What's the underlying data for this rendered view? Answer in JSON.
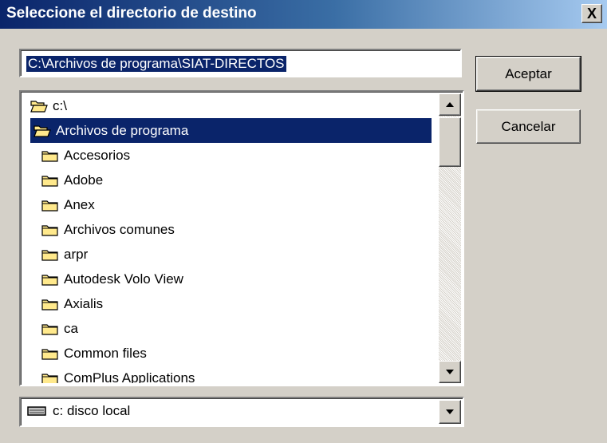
{
  "window": {
    "title": "Seleccione el directorio de destino",
    "close_label": "X"
  },
  "path": {
    "value": "C:\\Archivos de programa\\SIAT-DIRECTOS"
  },
  "buttons": {
    "ok": "Aceptar",
    "cancel": "Cancelar"
  },
  "tree": {
    "items": [
      {
        "label": "c:\\",
        "icon": "open-folder-icon",
        "level": 0,
        "selected": false
      },
      {
        "label": "Archivos de programa",
        "icon": "open-folder-icon",
        "level": 1,
        "selected": true
      },
      {
        "label": "Accesorios",
        "icon": "folder-icon",
        "level": 2,
        "selected": false
      },
      {
        "label": "Adobe",
        "icon": "folder-icon",
        "level": 2,
        "selected": false
      },
      {
        "label": "Anex",
        "icon": "folder-icon",
        "level": 2,
        "selected": false
      },
      {
        "label": "Archivos comunes",
        "icon": "folder-icon",
        "level": 2,
        "selected": false
      },
      {
        "label": "arpr",
        "icon": "folder-icon",
        "level": 2,
        "selected": false
      },
      {
        "label": "Autodesk Volo View",
        "icon": "folder-icon",
        "level": 2,
        "selected": false
      },
      {
        "label": "Axialis",
        "icon": "folder-icon",
        "level": 2,
        "selected": false
      },
      {
        "label": "ca",
        "icon": "folder-icon",
        "level": 2,
        "selected": false
      },
      {
        "label": "Common files",
        "icon": "folder-icon",
        "level": 2,
        "selected": false
      },
      {
        "label": "ComPlus Applications",
        "icon": "folder-icon",
        "level": 2,
        "selected": false
      }
    ],
    "scroll_position": 0.0
  },
  "drive": {
    "value": "c:  disco local",
    "icon": "hard-drive-icon"
  },
  "colors": {
    "selection": "#0a246a",
    "folder": "#ffe98c",
    "face": "#d4d0c8"
  }
}
